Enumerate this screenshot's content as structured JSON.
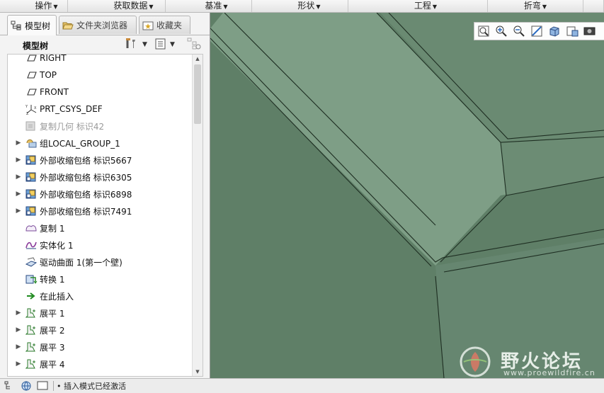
{
  "ribbon": {
    "groups": [
      {
        "label": "操作"
      },
      {
        "label": "获取数据"
      },
      {
        "label": "基准"
      },
      {
        "label": "形状"
      },
      {
        "label": "工程"
      },
      {
        "label": "折弯"
      }
    ]
  },
  "navigator": {
    "tabs": [
      {
        "label": "模型树",
        "icon": "model-tree-icon",
        "active": true
      },
      {
        "label": "文件夹浏览器",
        "icon": "folder-browser-icon"
      },
      {
        "label": "收藏夹",
        "icon": "favorites-icon"
      }
    ],
    "toolbar": {
      "title": "模型树",
      "settings_icon": "tools-icon",
      "show_icon": "list-icon",
      "filter_icon": "tree-filter-icon"
    },
    "tree": [
      {
        "label": "RIGHT",
        "icon": "datum-plane-icon",
        "expandable": false
      },
      {
        "label": "TOP",
        "icon": "datum-plane-icon",
        "expandable": false
      },
      {
        "label": "FRONT",
        "icon": "datum-plane-icon",
        "expandable": false
      },
      {
        "label": "PRT_CSYS_DEF",
        "icon": "coordinate-system-icon",
        "expandable": false
      },
      {
        "label": "复制几何 标识42",
        "icon": "copy-geometry-icon",
        "expandable": false,
        "dim": true
      },
      {
        "label": "组LOCAL_GROUP_1",
        "icon": "group-icon",
        "expandable": true
      },
      {
        "label": "外部收缩包络 标识5667",
        "icon": "shrinkwrap-icon",
        "expandable": true
      },
      {
        "label": "外部收缩包络 标识6305",
        "icon": "shrinkwrap-icon",
        "expandable": true
      },
      {
        "label": "外部收缩包络 标识6898",
        "icon": "shrinkwrap-icon",
        "expandable": true
      },
      {
        "label": "外部收缩包络 标识7491",
        "icon": "shrinkwrap-icon",
        "expandable": true
      },
      {
        "label": "复制 1",
        "icon": "copy-surface-icon",
        "expandable": false
      },
      {
        "label": "实体化 1",
        "icon": "solidify-icon",
        "expandable": false
      },
      {
        "label": "驱动曲面 1(第一个壁)",
        "icon": "driving-surface-icon",
        "expandable": false
      },
      {
        "label": "转换 1",
        "icon": "convert-icon",
        "expandable": false
      },
      {
        "label": "在此插入",
        "icon": "insert-here-arrow-icon",
        "expandable": false
      },
      {
        "label": "展平 1",
        "icon": "flatten-icon",
        "expandable": true
      },
      {
        "label": "展平 2",
        "icon": "flatten-icon",
        "expandable": true
      },
      {
        "label": "展平 3",
        "icon": "flatten-icon",
        "expandable": true
      },
      {
        "label": "展平 4",
        "icon": "flatten-icon",
        "expandable": true
      }
    ]
  },
  "view_toolbar": {
    "icons": [
      "refit-icon",
      "zoom-in-icon",
      "zoom-out-icon",
      "repaint-icon",
      "display-style-icon",
      "saved-views-icon",
      "screenshot-icon"
    ]
  },
  "watermark": {
    "title": "野火论坛",
    "url": "www.proewildfire.cn"
  },
  "status": {
    "message": "• 插入模式已经激活"
  },
  "colors": {
    "viewport_bg": "#5f7f67",
    "surface_light": "#7e9e86",
    "surface_mid": "#6f8f77",
    "edge": "#1e2e22"
  }
}
